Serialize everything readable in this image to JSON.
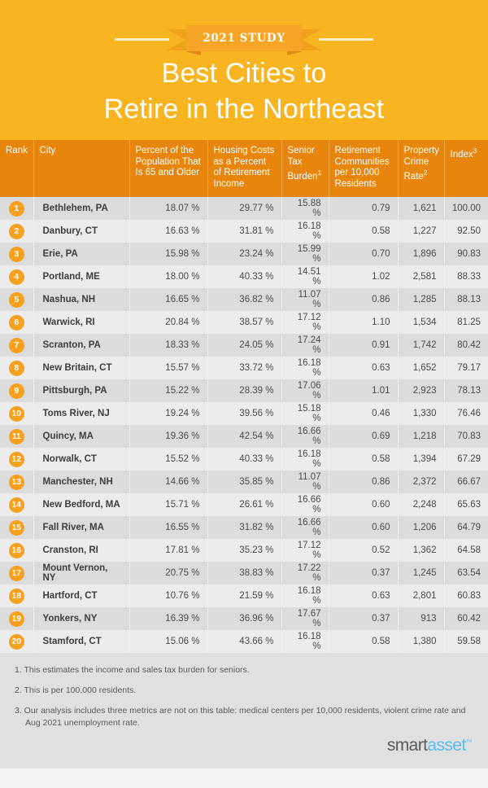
{
  "header": {
    "ribbon_label": "2021 STUDY",
    "title_line1": "Best Cities to",
    "title_line2": "Retire in the Northeast",
    "background_color": "#f9b422",
    "ribbon_color": "#f7a526"
  },
  "table": {
    "columns": [
      "Rank",
      "City",
      "Percent of the Population That Is 65 and Older",
      "Housing Costs as a Percent of Retirement Income",
      "Senior Tax Burden",
      "Retirement Communities per 10,000 Residents",
      "Property Crime Rate",
      "Index"
    ],
    "column_superscripts": [
      "",
      "",
      "",
      "",
      "1",
      "",
      "2",
      "3"
    ],
    "header_background": "#e8850c",
    "rows": [
      {
        "rank": "1",
        "city": "Bethlehem, PA",
        "pct65": "18.07 %",
        "housing": "29.77 %",
        "tax": "15.88 %",
        "communities": "0.79",
        "crime": "1,621",
        "index": "100.00"
      },
      {
        "rank": "2",
        "city": "Danbury, CT",
        "pct65": "16.63 %",
        "housing": "31.81 %",
        "tax": "16.18 %",
        "communities": "0.58",
        "crime": "1,227",
        "index": "92.50"
      },
      {
        "rank": "3",
        "city": "Erie, PA",
        "pct65": "15.98 %",
        "housing": "23.24 %",
        "tax": "15.99 %",
        "communities": "0.70",
        "crime": "1,896",
        "index": "90.83"
      },
      {
        "rank": "4",
        "city": "Portland, ME",
        "pct65": "18.00 %",
        "housing": "40.33 %",
        "tax": "14.51 %",
        "communities": "1.02",
        "crime": "2,581",
        "index": "88.33"
      },
      {
        "rank": "5",
        "city": "Nashua, NH",
        "pct65": "16.65 %",
        "housing": "36.82 %",
        "tax": "11.07 %",
        "communities": "0.86",
        "crime": "1,285",
        "index": "88.13"
      },
      {
        "rank": "6",
        "city": "Warwick, RI",
        "pct65": "20.84 %",
        "housing": "38.57 %",
        "tax": "17.12 %",
        "communities": "1.10",
        "crime": "1,534",
        "index": "81.25"
      },
      {
        "rank": "7",
        "city": "Scranton, PA",
        "pct65": "18.33 %",
        "housing": "24.05 %",
        "tax": "17.24 %",
        "communities": "0.91",
        "crime": "1,742",
        "index": "80.42"
      },
      {
        "rank": "8",
        "city": "New Britain, CT",
        "pct65": "15.57 %",
        "housing": "33.72 %",
        "tax": "16.18 %",
        "communities": "0.63",
        "crime": "1,652",
        "index": "79.17"
      },
      {
        "rank": "9",
        "city": "Pittsburgh, PA",
        "pct65": "15.22 %",
        "housing": "28.39 %",
        "tax": "17.06 %",
        "communities": "1.01",
        "crime": "2,923",
        "index": "78.13"
      },
      {
        "rank": "10",
        "city": "Toms River, NJ",
        "pct65": "19.24 %",
        "housing": "39.56 %",
        "tax": "15.18 %",
        "communities": "0.46",
        "crime": "1,330",
        "index": "76.46"
      },
      {
        "rank": "11",
        "city": "Quincy, MA",
        "pct65": "19.36 %",
        "housing": "42.54 %",
        "tax": "16.66 %",
        "communities": "0.69",
        "crime": "1,218",
        "index": "70.83"
      },
      {
        "rank": "12",
        "city": "Norwalk, CT",
        "pct65": "15.52 %",
        "housing": "40.33 %",
        "tax": "16.18 %",
        "communities": "0.58",
        "crime": "1,394",
        "index": "67.29"
      },
      {
        "rank": "13",
        "city": "Manchester, NH",
        "pct65": "14.66 %",
        "housing": "35.85 %",
        "tax": "11.07 %",
        "communities": "0.86",
        "crime": "2,372",
        "index": "66.67"
      },
      {
        "rank": "14",
        "city": "New Bedford, MA",
        "pct65": "15.71 %",
        "housing": "26.61 %",
        "tax": "16.66 %",
        "communities": "0.60",
        "crime": "2,248",
        "index": "65.63"
      },
      {
        "rank": "15",
        "city": "Fall River, MA",
        "pct65": "16.55 %",
        "housing": "31.82 %",
        "tax": "16.66 %",
        "communities": "0.60",
        "crime": "1,206",
        "index": "64.79"
      },
      {
        "rank": "16",
        "city": "Cranston, RI",
        "pct65": "17.81 %",
        "housing": "35.23 %",
        "tax": "17.12 %",
        "communities": "0.52",
        "crime": "1,362",
        "index": "64.58"
      },
      {
        "rank": "17",
        "city": "Mount Vernon, NY",
        "pct65": "20.75 %",
        "housing": "38.83 %",
        "tax": "17.22 %",
        "communities": "0.37",
        "crime": "1,245",
        "index": "63.54"
      },
      {
        "rank": "18",
        "city": "Hartford, CT",
        "pct65": "10.76 %",
        "housing": "21.59 %",
        "tax": "16.18 %",
        "communities": "0.63",
        "crime": "2,801",
        "index": "60.83"
      },
      {
        "rank": "19",
        "city": "Yonkers, NY",
        "pct65": "16.39 %",
        "housing": "36.96 %",
        "tax": "17.67 %",
        "communities": "0.37",
        "crime": "913",
        "index": "60.42"
      },
      {
        "rank": "20",
        "city": "Stamford, CT",
        "pct65": "15.06 %",
        "housing": "43.66 %",
        "tax": "16.18 %",
        "communities": "0.58",
        "crime": "1,380",
        "index": "59.58"
      }
    ]
  },
  "footnotes": [
    "1. This estimates the income and sales tax burden for seniors.",
    "2. This is per 100,000 residents.",
    "3. Our analysis includes three metrics are not on this table: medical centers per 10,000 residents, violent crime rate and Aug 2021 unemployment rate."
  ],
  "logo": {
    "part1": "smart",
    "part2": "asset",
    "trademark": "™"
  }
}
